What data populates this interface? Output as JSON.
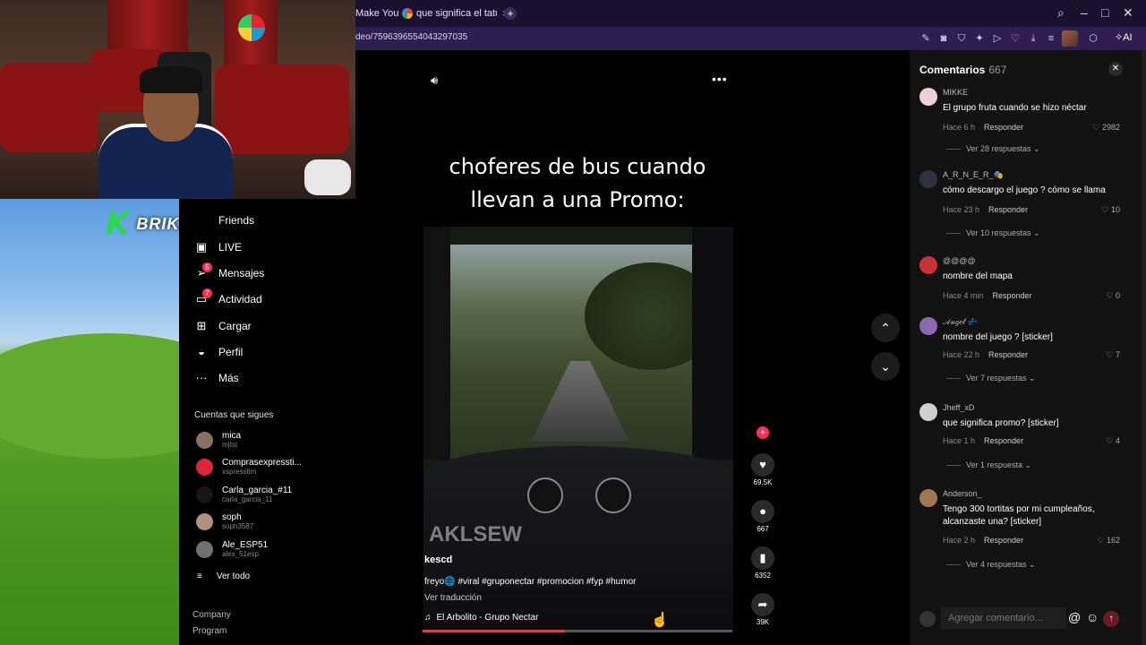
{
  "overlay": {
    "brand_letter": "K",
    "brand_name": "BRIKZZO"
  },
  "browser": {
    "tabs": [
      {
        "label": "Make Your D"
      },
      {
        "label": "que significa el tatuaje de"
      }
    ],
    "url": "deo/7596396554043297035",
    "ai_label": "AI"
  },
  "leftnav": {
    "items": [
      {
        "label": "Friends",
        "icon": "friends-icon"
      },
      {
        "label": "LIVE",
        "icon": "live-icon"
      },
      {
        "label": "Mensajes",
        "icon": "messages-icon",
        "badge": "5"
      },
      {
        "label": "Actividad",
        "icon": "activity-icon",
        "badge": "7"
      },
      {
        "label": "Cargar",
        "icon": "upload-icon"
      },
      {
        "label": "Perfil",
        "icon": "profile-icon"
      },
      {
        "label": "Más",
        "icon": "more-icon"
      }
    ],
    "following_title": "Cuentas que sigues",
    "following": [
      {
        "name": "mica",
        "handle": "m|ts|"
      },
      {
        "name": "Comprasexpressti...",
        "handle": "xspresstim"
      },
      {
        "name": "Carla_garcia_#11",
        "handle": "carla_garcia_11"
      },
      {
        "name": "soph",
        "handle": "soph3587"
      },
      {
        "name": "Ale_ESP51",
        "handle": "alex_51esp"
      }
    ],
    "see_all": "Ver todo",
    "footer": [
      "Company",
      "Program"
    ]
  },
  "video": {
    "title_line1": "choferes de bus cuando",
    "title_line2": "llevan a una Promo:",
    "watermark": "AKLSEW",
    "author": "kescd",
    "caption": "freyo🌐 #viral #gruponectar #promocion #fyp #humor",
    "translate": "Ver traducción",
    "sound": "El Arbolito - Grupo Nectar",
    "progress": 0.46,
    "likes": "69.5K",
    "comments": "667",
    "saves": "6352",
    "shares": "39K"
  },
  "comments": {
    "title": "Comentarios",
    "count": "667",
    "placeholder": "Agregar comentario...",
    "items": [
      {
        "user": "MIKKE",
        "text": "El grupo fruta cuando se hizo néctar",
        "time": "Hace 6 h",
        "reply": "Responder",
        "likes": "2982",
        "more": "Ver 28 respuestas"
      },
      {
        "user": "A_R_N_E_R_🎭",
        "text": "cómo descargo el juego ? cómo se llama",
        "time": "Hace 23 h",
        "reply": "Responder",
        "likes": "10",
        "more": "Ver 10 respuestas"
      },
      {
        "user": "@@@@",
        "text": "nombre del mapa",
        "time": "Hace 4 min",
        "reply": "Responder",
        "likes": "0",
        "more": ""
      },
      {
        "user": "𝒜𝓃𝑔𝑒𝓁 💤",
        "text": "nombre del juego ? [sticker]",
        "time": "Hace 22 h",
        "reply": "Responder",
        "likes": "7",
        "more": "Ver 7 respuestas"
      },
      {
        "user": "Jheff_xD",
        "text": "que significa promo? [sticker]",
        "time": "Hace 1 h",
        "reply": "Responder",
        "likes": "4",
        "more": "Ver 1 respuesta"
      },
      {
        "user": "Anderson_",
        "text": "Tengo 300 tortitas por mi cumpleaños, alcanzaste una? [sticker]",
        "time": "Hace 2 h",
        "reply": "Responder",
        "likes": "162",
        "more": "Ver 4 respuestas"
      }
    ]
  },
  "colors": {
    "accent": "#fe2c55",
    "browser_bg": "#1a1030",
    "address_bg": "#2e1e52",
    "brand_green": "#29d94a"
  }
}
